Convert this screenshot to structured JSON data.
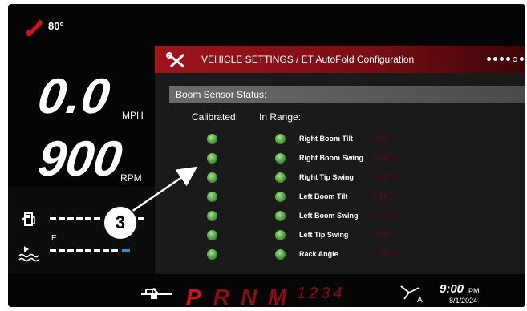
{
  "status": {
    "temperature": "80°",
    "temp_icon": "thermometer-icon"
  },
  "gauges": {
    "speed_value": "0.0",
    "speed_unit": "MPH",
    "rpm_value": "900",
    "rpm_unit": "RPM",
    "fuel_empty_label": "E"
  },
  "panel": {
    "title": "VEHICLE SETTINGS / ET AutoFold Configuration",
    "section": "Boom Sensor Status:",
    "col_calibrated": "Calibrated:",
    "col_in_range": "In Range:",
    "rows": [
      {
        "label": "Right Boom Tilt",
        "voltage": "4.50 V"
      },
      {
        "label": "Right Boom Swing",
        "voltage": "3.40 V"
      },
      {
        "label": "Right Tip Swing",
        "voltage": "4.20 V"
      },
      {
        "label": "Left Boom Tilt",
        "voltage": "1.16 V"
      },
      {
        "label": "Left Boom Swing",
        "voltage": "1.27 V"
      },
      {
        "label": "Left Tip Swing",
        "voltage": "4.55 V"
      },
      {
        "label": "Rack Angle",
        "voltage": "0.00 V"
      }
    ],
    "page_dots": 6,
    "active_dot": 5
  },
  "gearbar": {
    "gears": [
      "P",
      "R",
      "N",
      "M"
    ],
    "numbers": "1234",
    "active": "P"
  },
  "clock": {
    "time": "9:00",
    "ampm": "PM",
    "date": "8/1/2024",
    "mode_icon_label": "A"
  },
  "annotation": {
    "callout": "3"
  },
  "colors": {
    "accent_red": "#a0141c",
    "led_green": "#3d8a2c",
    "fuel_blue": "#2a8fd8"
  }
}
